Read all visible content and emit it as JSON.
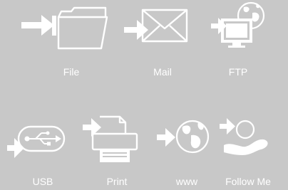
{
  "colors": {
    "background": "#c8c8c8",
    "foreground": "#ffffff"
  },
  "items": [
    {
      "label": "File",
      "icon": "folder-arrow-icon"
    },
    {
      "label": "Mail",
      "icon": "envelope-arrow-icon"
    },
    {
      "label": "FTP",
      "icon": "monitor-globe-arrow-icon"
    },
    {
      "label": "USB",
      "icon": "usb-arrow-icon"
    },
    {
      "label": "Print",
      "icon": "printer-arrow-icon"
    },
    {
      "label": "www",
      "icon": "globe-arrow-icon"
    },
    {
      "label": "Follow Me",
      "icon": "hand-arrow-icon"
    }
  ]
}
